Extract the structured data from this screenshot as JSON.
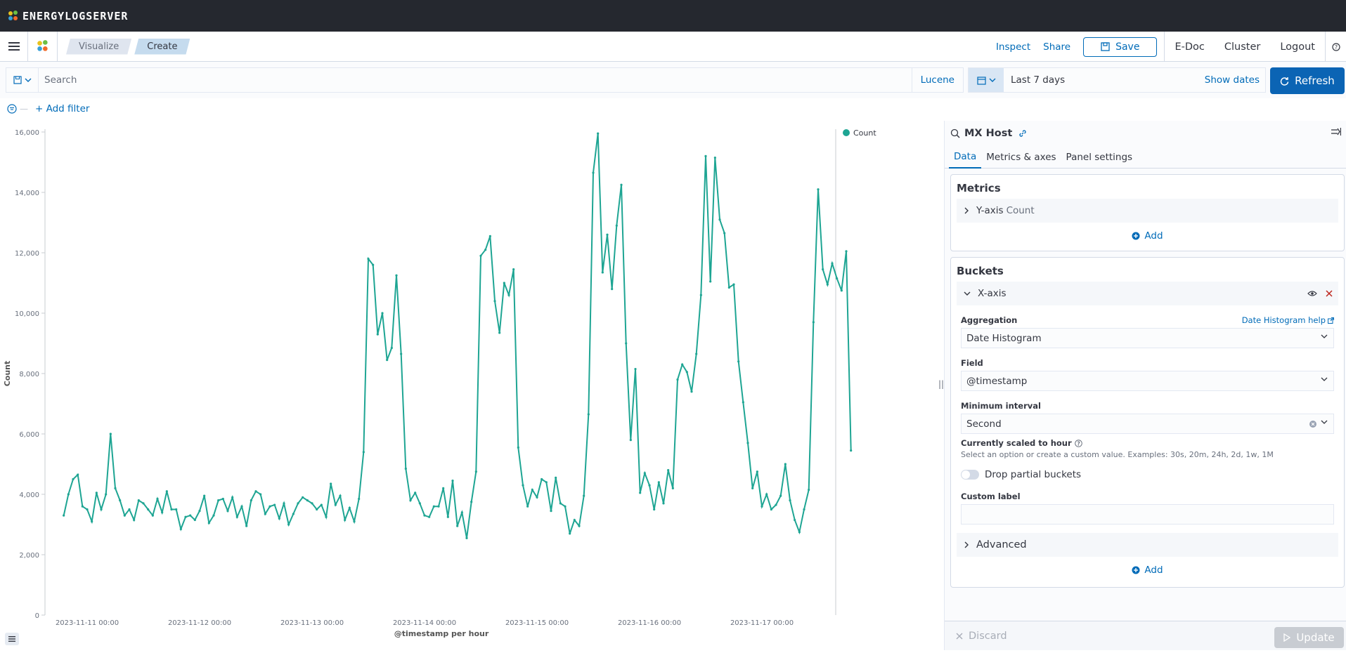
{
  "app": {
    "brand": "ENERGYLOGSERVER"
  },
  "breadcrumbs": [
    "Visualize",
    "Create"
  ],
  "nav": {
    "inspect": "Inspect",
    "share": "Share",
    "save": "Save",
    "items": [
      "E-Doc",
      "Cluster",
      "Logout"
    ]
  },
  "query": {
    "placeholder": "Search",
    "language": "Lucene",
    "date_range": "Last 7 days",
    "show_dates": "Show dates",
    "refresh": "Refresh"
  },
  "filter": {
    "add_filter": "+ Add filter"
  },
  "chart_data": {
    "type": "line",
    "xlabel": "@timestamp per hour",
    "ylabel": "Count",
    "ylim": [
      0,
      16000
    ],
    "y_ticks": [
      "0",
      "2,000",
      "4,000",
      "6,000",
      "8,000",
      "10,000",
      "12,000",
      "14,000",
      "16,000"
    ],
    "x_ticks": [
      "2023-11-11 00:00",
      "2023-11-12 00:00",
      "2023-11-13 00:00",
      "2023-11-14 00:00",
      "2023-11-15 00:00",
      "2023-11-16 00:00",
      "2023-11-17 00:00"
    ],
    "legend": "Count",
    "legend_position": "top-right",
    "color": "#1ea593",
    "x_start": "2023-11-10 19:00",
    "interval": "1h",
    "series": [
      {
        "values": [
          3300,
          4000,
          4500,
          4650,
          3600,
          3500,
          3100,
          4050,
          3500,
          4000,
          6000,
          4200,
          3800,
          3300,
          3500,
          3150,
          3800,
          3700,
          3500,
          3300,
          3850,
          3400,
          4100,
          3500,
          3500,
          2850,
          3250,
          3300,
          3150,
          3450,
          3950,
          3050,
          3300,
          3800,
          3850,
          3450,
          3900,
          3250,
          3600,
          2950,
          3800,
          4100,
          4000,
          3350,
          3600,
          3650,
          3200,
          3700,
          3000,
          3350,
          3700,
          3900,
          3800,
          3700,
          3500,
          3650,
          3250,
          4350,
          3650,
          3950,
          3150,
          3550,
          3100,
          3850,
          5400,
          11800,
          11600,
          9300,
          10000,
          8450,
          8850,
          11250,
          8650,
          4850,
          3800,
          4050,
          3700,
          3300,
          3250,
          3600,
          3600,
          4200,
          3250,
          4450,
          2950,
          3400,
          2550,
          3750,
          4750,
          11900,
          12100,
          12550,
          10400,
          9350,
          11000,
          10600,
          11450,
          5550,
          4300,
          3600,
          4150,
          3900,
          4500,
          4400,
          3450,
          4550,
          3700,
          3600,
          2700,
          3150,
          2950,
          3950,
          6650,
          14650,
          15950,
          11350,
          12600,
          10800,
          12900,
          14250,
          9000,
          5800,
          8150,
          4050,
          4700,
          4300,
          3500,
          4400,
          3700,
          4800,
          4200,
          7800,
          8300,
          8050,
          7400,
          8650,
          10600,
          15200,
          11050,
          15150,
          13100,
          12650,
          10850,
          10950,
          8400,
          7050,
          5700,
          4200,
          4750,
          3600,
          4000,
          3500,
          3650,
          3950,
          5000,
          3800,
          3150,
          2750,
          3500,
          4150,
          9700,
          14100,
          11450,
          10950,
          11650,
          11150,
          10750,
          12050,
          5450
        ]
      }
    ]
  },
  "sidebar": {
    "title": "MX Host",
    "tabs": [
      "Data",
      "Metrics & axes",
      "Panel settings"
    ],
    "metrics": {
      "title": "Metrics",
      "row_label": "Y-axis",
      "row_sub": "Count",
      "add": "Add"
    },
    "buckets": {
      "title": "Buckets",
      "row_label": "X-axis",
      "aggregation_label": "Aggregation",
      "aggregation_help": "Date Histogram help",
      "aggregation_value": "Date Histogram",
      "field_label": "Field",
      "field_value": "@timestamp",
      "interval_label": "Minimum interval",
      "interval_value": "Second",
      "scaled_note": "Currently scaled to hour",
      "interval_hint": "Select an option or create a custom value. Examples: 30s, 20m, 24h, 2d, 1w, 1M",
      "drop_partial": "Drop partial buckets",
      "custom_label": "Custom label",
      "advanced": "Advanced",
      "add": "Add"
    },
    "discard": "Discard",
    "update": "Update"
  }
}
